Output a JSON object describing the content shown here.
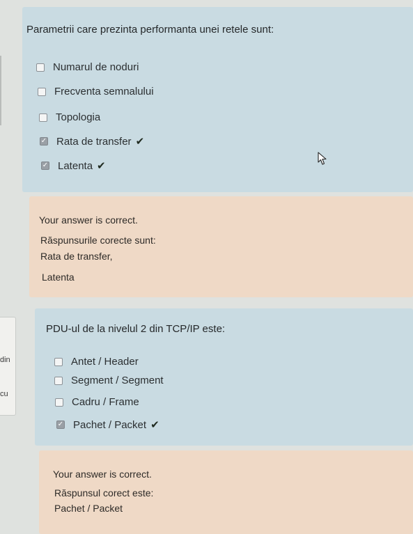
{
  "sidebar": {
    "fragments": [
      "din",
      "cu"
    ]
  },
  "question1": {
    "text": "Parametrii care prezinta performanta unei retele sunt:",
    "options": [
      {
        "label": "Numarul de noduri",
        "checked": false,
        "correct": false
      },
      {
        "label": "Frecventa semnalului",
        "checked": false,
        "correct": false
      },
      {
        "label": "Topologia",
        "checked": false,
        "correct": false
      },
      {
        "label": "Rata de transfer",
        "checked": true,
        "correct": true
      },
      {
        "label": "Latenta",
        "checked": true,
        "correct": true
      }
    ]
  },
  "feedback1": {
    "status": "Your answer is correct.",
    "heading": "Răspunsurile corecte sunt:",
    "lines": [
      "Rata de transfer,",
      "Latenta"
    ]
  },
  "question2": {
    "text": "PDU-ul de la nivelul 2 din TCP/IP este:",
    "options": [
      {
        "label": "Antet / Header",
        "checked": false,
        "correct": false
      },
      {
        "label": "Segment / Segment",
        "checked": false,
        "correct": false
      },
      {
        "label": "Cadru / Frame",
        "checked": false,
        "correct": false
      },
      {
        "label": "Pachet / Packet",
        "checked": true,
        "correct": true
      }
    ]
  },
  "feedback2": {
    "status": "Your answer is correct.",
    "heading": "Răspunsul corect este:",
    "lines": [
      "Pachet / Packet"
    ]
  },
  "icons": {
    "checkmark": "✔",
    "checkbox_mark": "✓"
  },
  "colors": {
    "question_bg": "#c9dbe2",
    "feedback_bg": "#efd9c6",
    "page_bg": "#dfe2df"
  }
}
